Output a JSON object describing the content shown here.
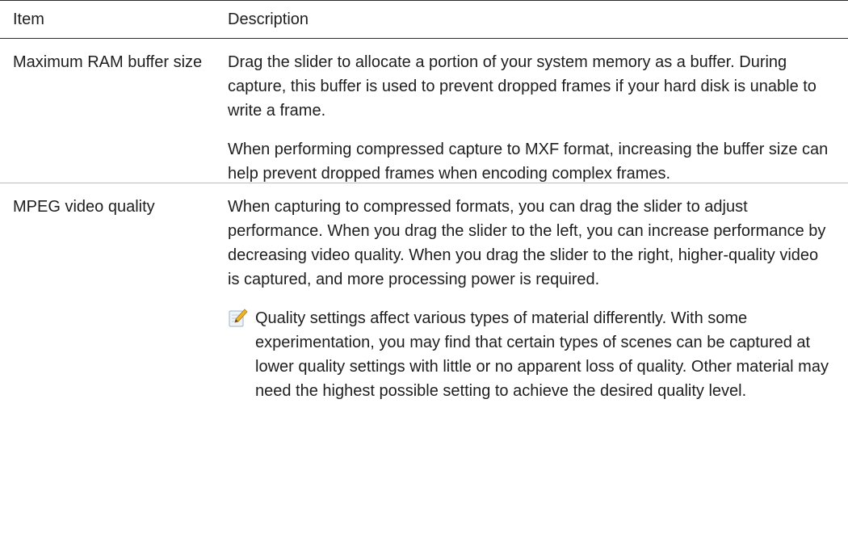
{
  "table": {
    "headers": {
      "item": "Item",
      "description": "Description"
    },
    "rows": [
      {
        "item": "Maximum RAM buffer size",
        "paragraphs": [
          "Drag the slider to allocate a portion of your system memory as a buffer. During capture, this buffer is used to prevent dropped frames if your hard disk is unable to write a frame.",
          "When performing compressed capture to MXF format, increasing the buffer size can help prevent dropped frames when encoding complex frames."
        ]
      },
      {
        "item": "MPEG video quality",
        "paragraphs": [
          "When capturing to compressed formats, you can drag the slider to adjust performance. When you drag the slider to the left, you can increase performance by decreasing video quality. When you drag the slider to the right, higher-quality video is captured, and more processing power is required."
        ],
        "note": {
          "icon": "note-pencil-icon",
          "text": "Quality settings affect various types of material differently. With some experimentation, you may find that certain types of scenes can be captured at lower quality settings with little or no apparent loss of quality. Other material may need the highest possible setting to achieve the desired quality level."
        }
      }
    ]
  }
}
